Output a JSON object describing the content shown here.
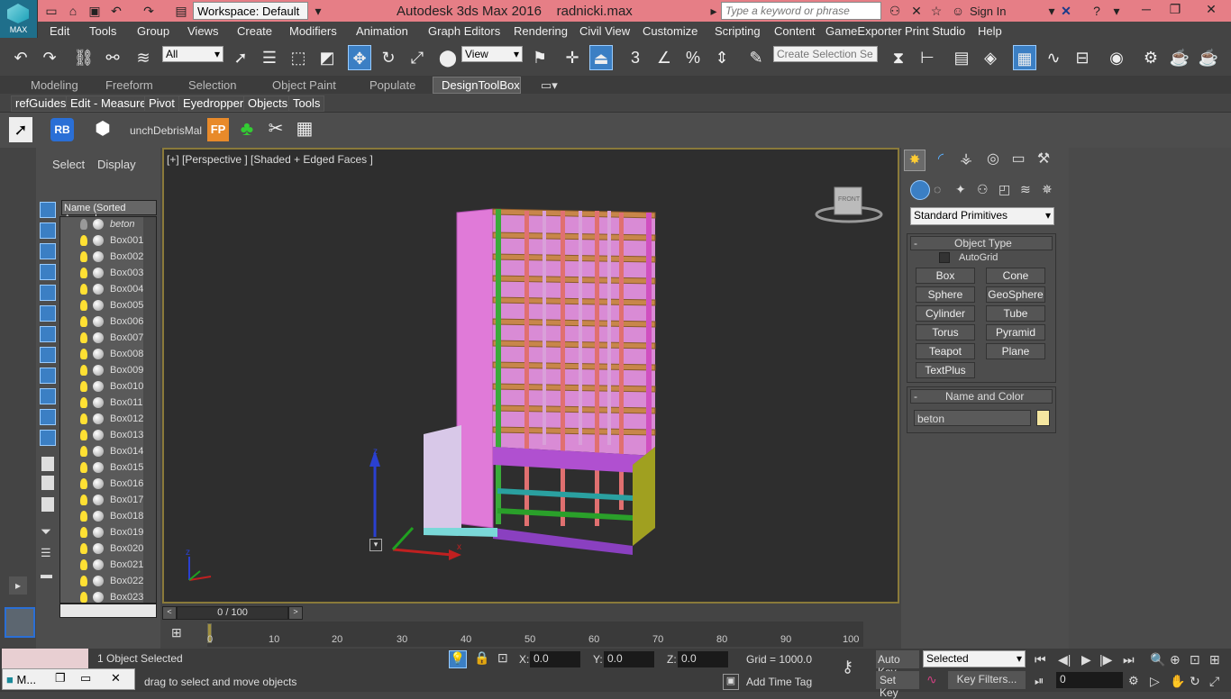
{
  "titlebar": {
    "app_title": "Autodesk 3ds Max 2016",
    "file_name": "radnicki.max",
    "workspace_label": "Workspace: Default",
    "search_placeholder": "Type a keyword or phrase",
    "sign_in": "Sign In",
    "logo_text": "MAX"
  },
  "menu": [
    "Edit",
    "Tools",
    "Group",
    "Views",
    "Create",
    "Modifiers",
    "Animation",
    "Graph Editors",
    "Rendering",
    "Civil View",
    "Customize",
    "Scripting",
    "Content",
    "GameExporter",
    "Print Studio",
    "Help"
  ],
  "toolbar": {
    "selection_filter": "All",
    "ref_coord": "View",
    "selection_set_placeholder": "Create Selection Se",
    "snap_3": "3",
    "snap_pct": "%"
  },
  "ribbon": {
    "tabs": [
      "Modeling",
      "Freeform",
      "Selection",
      "Object Paint",
      "Populate",
      "DesignToolBox"
    ],
    "active_tab": "DesignToolBox",
    "subtabs": [
      "refGuides",
      "Edit - Measure",
      "Pivot",
      "Eyedropper",
      "Objects",
      "Tools"
    ],
    "panel_rb": "RB",
    "panel_fp": "FP",
    "panel_text": "unchDebrisMal"
  },
  "explorer": {
    "tab_select": "Select",
    "tab_display": "Display",
    "column_header": "Name (Sorted Ascend",
    "items": [
      "beton",
      "Box001",
      "Box002",
      "Box003",
      "Box004",
      "Box005",
      "Box006",
      "Box007",
      "Box008",
      "Box009",
      "Box010",
      "Box011",
      "Box012",
      "Box013",
      "Box014",
      "Box015",
      "Box016",
      "Box017",
      "Box018",
      "Box019",
      "Box020",
      "Box021",
      "Box022",
      "Box023"
    ]
  },
  "viewport": {
    "label": "[+] [Perspective ] [Shaded + Edged Faces ]",
    "viewcube_label": "FRONT",
    "axis_x": "x",
    "axis_z": "z"
  },
  "command_panel": {
    "category_dropdown": "Standard Primitives",
    "object_type_title": "Object Type",
    "autogrid": "AutoGrid",
    "buttons": [
      "Box",
      "Cone",
      "Sphere",
      "GeoSphere",
      "Cylinder",
      "Tube",
      "Torus",
      "Pyramid",
      "Teapot",
      "Plane",
      "TextPlus"
    ],
    "name_color_title": "Name and Color",
    "object_name": "beton",
    "object_color": "#f5e6a0",
    "rollout_minus": "-"
  },
  "timeline": {
    "frame_counter": "0 / 100",
    "ticks": [
      "0",
      "10",
      "20",
      "30",
      "40",
      "50",
      "60",
      "70",
      "80",
      "90",
      "100"
    ]
  },
  "status": {
    "selected_text": "1 Object Selected",
    "prompt_text": "drag to select and move objects",
    "x_label": "X:",
    "x_value": "0.0",
    "y_label": "Y:",
    "y_value": "0.0",
    "z_label": "Z:",
    "z_value": "0.0",
    "grid": "Grid = 1000.0",
    "add_time_tag": "Add Time Tag",
    "auto_key": "Auto Key",
    "set_key": "Set Key",
    "key_mode": "Selected",
    "key_filters": "Key Filters...",
    "frame_value": "0",
    "taskbar_item": "M..."
  }
}
